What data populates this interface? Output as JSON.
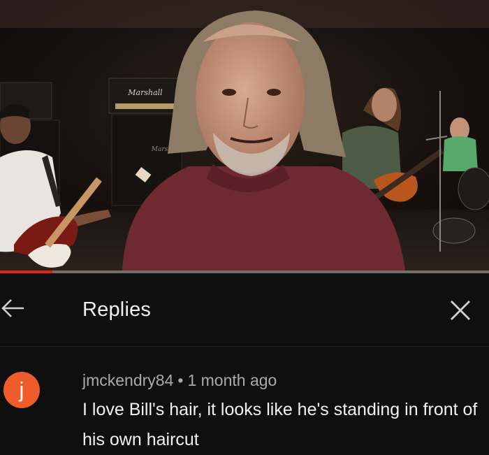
{
  "video": {
    "amp_brand": "Marshall",
    "progress_fraction": 0.107
  },
  "replies": {
    "title": "Replies",
    "back_icon": "arrow-left-icon",
    "close_icon": "close-icon"
  },
  "comment": {
    "avatar_letter": "j",
    "avatar_color": "#ef5c2c",
    "username": "jmckendry84",
    "separator": "•",
    "time": "1 month ago",
    "text": "I love Bill's hair, it looks like he's standing in front of his own haircut"
  }
}
